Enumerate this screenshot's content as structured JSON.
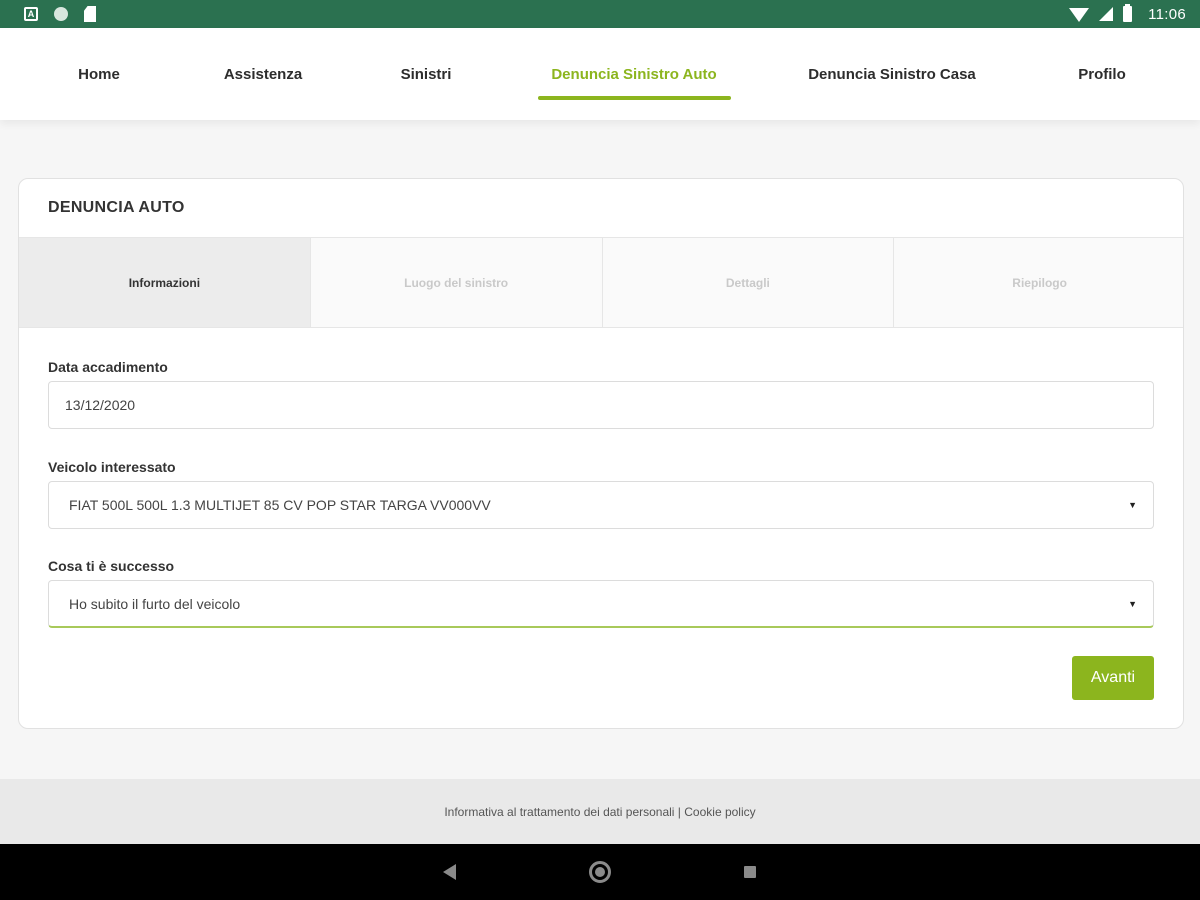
{
  "status_bar": {
    "time": "11:06",
    "notification_icons": [
      "a-icon",
      "circle-icon",
      "sd-card-icon"
    ],
    "system_icons": [
      "wifi-icon",
      "signal-icon",
      "battery-icon"
    ]
  },
  "nav": {
    "items": [
      {
        "label": "Home"
      },
      {
        "label": "Assistenza"
      },
      {
        "label": "Sinistri"
      },
      {
        "label": "Denuncia Sinistro Auto",
        "active": true
      },
      {
        "label": "Denuncia Sinistro Casa"
      },
      {
        "label": "Profilo"
      }
    ]
  },
  "card": {
    "title": "DENUNCIA AUTO",
    "steps": [
      {
        "label": "Informazioni",
        "active": true
      },
      {
        "label": "Luogo del sinistro"
      },
      {
        "label": "Dettagli"
      },
      {
        "label": "Riepilogo"
      }
    ],
    "fields": {
      "date": {
        "label": "Data accadimento",
        "value": "13/12/2020"
      },
      "vehicle": {
        "label": "Veicolo interessato",
        "value": "FIAT 500L 500L 1.3 MULTIJET 85 CV POP STAR TARGA VV000VV"
      },
      "event": {
        "label": "Cosa ti è successo",
        "value": "Ho subito il furto del veicolo"
      }
    },
    "next_button": "Avanti"
  },
  "footer": {
    "privacy_link": "Informativa al trattamento dei dati personali",
    "separator": " | ",
    "cookie_link": "Cookie policy"
  },
  "colors": {
    "status_bar": "#2b7150",
    "accent": "#8cb51e"
  }
}
